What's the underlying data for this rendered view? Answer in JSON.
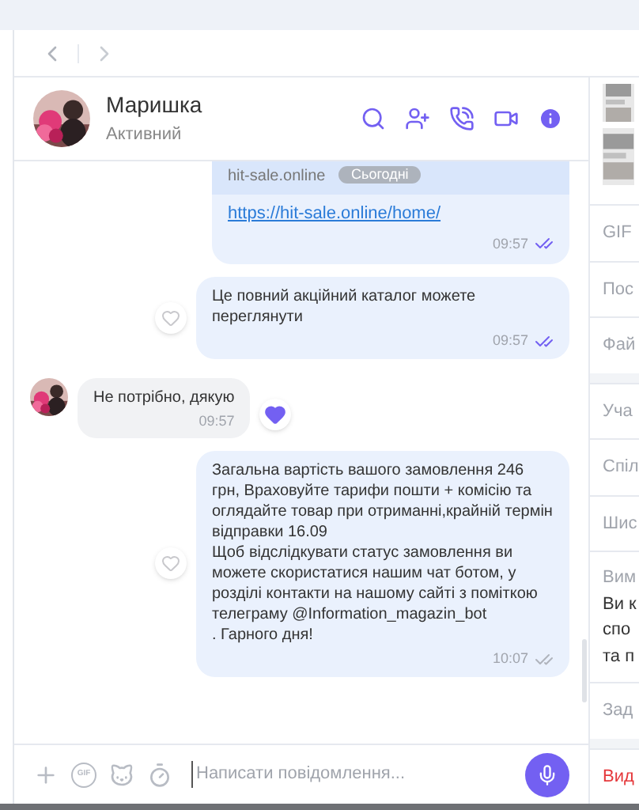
{
  "contact": {
    "name": "Маришка",
    "status": "Активний"
  },
  "date_pill": "Сьогодні",
  "messages": [
    {
      "kind": "link",
      "preview_title": "hit-sale.online",
      "link": "https://hit-sale.online/home/",
      "time": "09:57",
      "read": true
    },
    {
      "kind": "outgoing",
      "paragraphs": [
        "Це повний акційний каталог можете переглянути"
      ],
      "time": "09:57",
      "read": true,
      "liked": false
    },
    {
      "kind": "incoming",
      "paragraphs": [
        "Не потрібно, дякую"
      ],
      "time": "09:57",
      "liked": true
    },
    {
      "kind": "outgoing",
      "paragraphs": [
        "Загальна вартість вашого замовлення 246 грн, Враховуйте тарифи пошти + комісію  та оглядайте товар при отриманні,крайній термін відправки 16.09",
        "Щоб відслідкувати статус замовлення ви можете скористатися нашим чат ботом, у розділі контакти на нашому сайті з поміткою телеграму @Information_magazin_bot",
        ". Гарного дня!"
      ],
      "time": "10:07",
      "read": false,
      "liked": false
    }
  ],
  "composer": {
    "gif_label": "GIF",
    "placeholder": "Написати повідомлення..."
  },
  "side_panel": {
    "sections": [
      {
        "kind": "label",
        "label": "GIF"
      },
      {
        "kind": "label",
        "label": "Пос"
      },
      {
        "kind": "label",
        "label": "Фай",
        "gap_after": true
      },
      {
        "kind": "label",
        "label": "Уча"
      },
      {
        "kind": "label",
        "label": "Спіл"
      },
      {
        "kind": "label",
        "label": "Шис"
      },
      {
        "kind": "note",
        "label": "Вим",
        "lines": [
          "Ви к",
          "спо",
          "та п"
        ]
      },
      {
        "kind": "label",
        "label": "Зад",
        "gap_after": true
      },
      {
        "kind": "danger",
        "label": "Вид"
      }
    ]
  }
}
